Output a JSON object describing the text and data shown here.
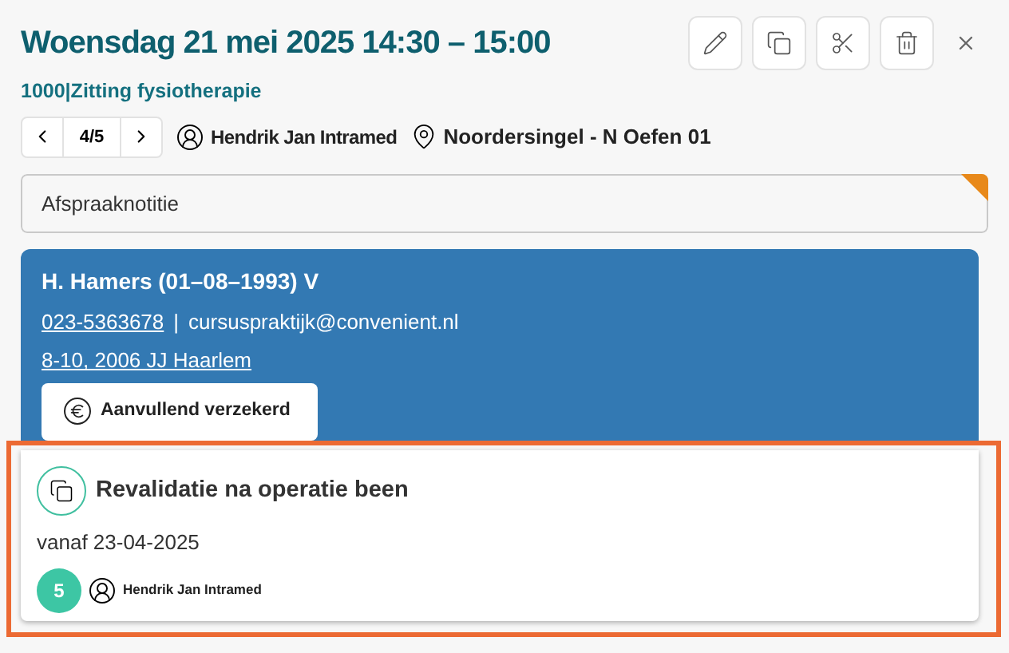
{
  "header": {
    "title": "Woensdag 21 mei 2025 14:30 – 15:00",
    "subtitle": "1000|Zitting fysiotherapie"
  },
  "pager": {
    "position": "4/5"
  },
  "practitioner": "Hendrik Jan Intramed",
  "location": "Noordersingel - N Oefen 01",
  "note": {
    "placeholder": "Afspraaknotitie",
    "flagged": true
  },
  "patient": {
    "name": "H. Hamers (01–08–1993) V",
    "phone": "023-5363678",
    "separator": "|",
    "email": "cursuspraktijk@convenient.nl",
    "address": "8-10, 2006 JJ Haarlem",
    "badge": "Aanvullend verzekerd"
  },
  "treatment": {
    "title": "Revalidatie na operatie been",
    "since": "vanaf 23-04-2025",
    "count": "5",
    "practitioner": "Hendrik Jan Intramed",
    "highlighted": true
  }
}
